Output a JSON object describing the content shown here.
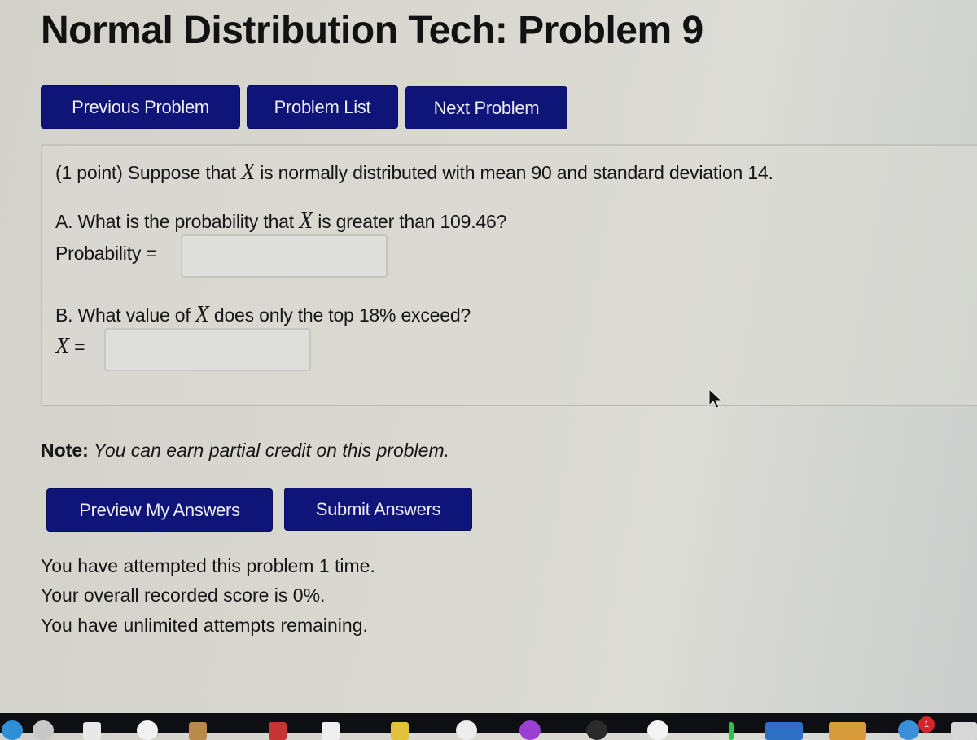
{
  "page": {
    "title": "Normal Distribution Tech: Problem 9"
  },
  "nav": {
    "previous_label": "Previous Problem",
    "list_label": "Problem List",
    "next_label": "Next Problem"
  },
  "problem": {
    "intro_prefix": "(1 point) Suppose that ",
    "variable": "X",
    "intro_suffix": " is normally distributed with mean 90 and standard deviation 14.",
    "part_a": {
      "question_prefix": "A. What is the probability that ",
      "question_suffix": " is greater than 109.46?",
      "answer_label": "Probability =",
      "answer_value": ""
    },
    "part_b": {
      "question_prefix": "B. What value of ",
      "question_suffix": " does only the top 18% exceed?",
      "answer_label_suffix": " =",
      "answer_value": ""
    }
  },
  "note": {
    "label": "Note:",
    "text": " You can earn partial credit on this problem."
  },
  "actions": {
    "preview_label": "Preview My Answers",
    "submit_label": "Submit Answers"
  },
  "status": {
    "attempts": "You have attempted this problem 1 time.",
    "score": "Your overall recorded score is 0%.",
    "remaining": "You have unlimited attempts remaining."
  },
  "dock": {
    "badge_count": "1"
  },
  "colors": {
    "button_bg": "#0f1478",
    "button_text": "#ecedf5"
  }
}
